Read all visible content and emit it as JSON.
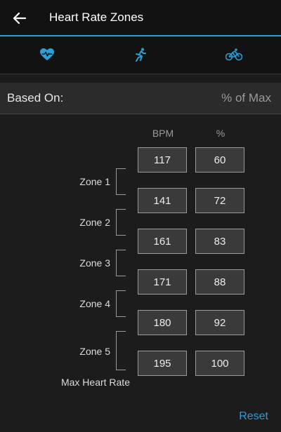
{
  "header": {
    "title": "Heart Rate Zones",
    "back_icon": "back-arrow-icon"
  },
  "tabs": [
    {
      "icon": "heart-rate-icon",
      "active": true
    },
    {
      "icon": "running-icon",
      "active": false
    },
    {
      "icon": "cycling-icon",
      "active": false
    }
  ],
  "based_on": {
    "label": "Based On:",
    "value": "% of Max"
  },
  "columns": {
    "bpm": "BPM",
    "pct": "%"
  },
  "zones": [
    {
      "label": "Zone 1"
    },
    {
      "label": "Zone 2"
    },
    {
      "label": "Zone 3"
    },
    {
      "label": "Zone 4"
    },
    {
      "label": "Zone 5"
    }
  ],
  "values": [
    {
      "bpm": "117",
      "pct": "60"
    },
    {
      "bpm": "141",
      "pct": "72"
    },
    {
      "bpm": "161",
      "pct": "83"
    },
    {
      "bpm": "171",
      "pct": "88"
    },
    {
      "bpm": "180",
      "pct": "92"
    },
    {
      "bpm": "195",
      "pct": "100"
    }
  ],
  "max_label": "Max Heart Rate",
  "reset_label": "Reset",
  "colors": {
    "accent": "#2a9fd8",
    "background": "#1c1c1c",
    "box": "#3a3a3a"
  }
}
